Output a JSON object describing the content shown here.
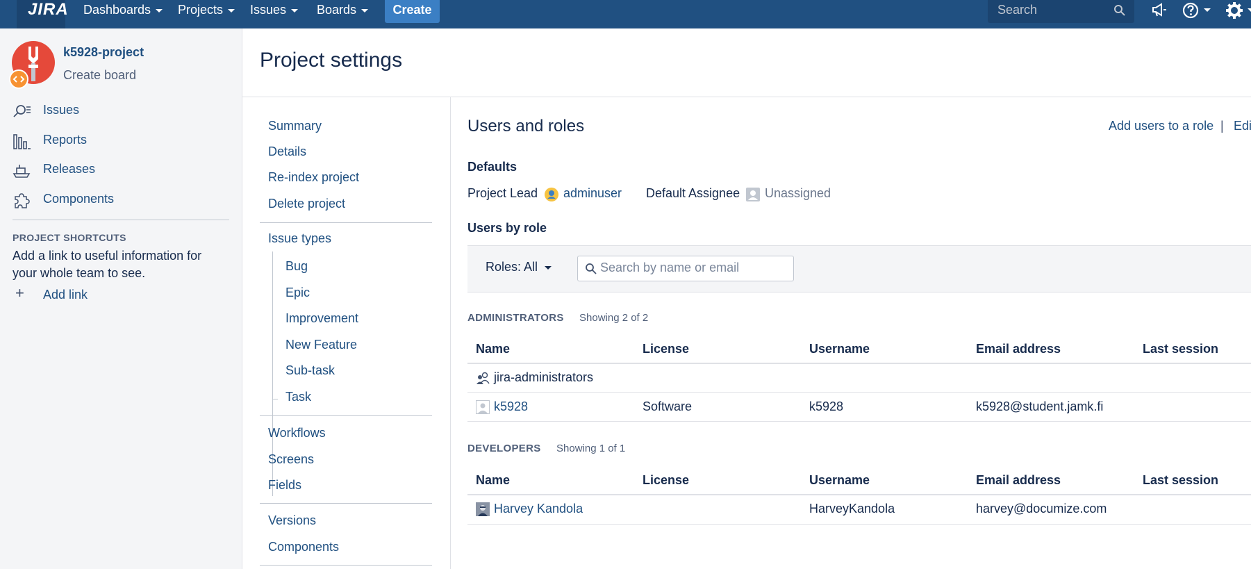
{
  "nav": {
    "logo": "JIRA",
    "items": [
      {
        "label": "Dashboards"
      },
      {
        "label": "Projects"
      },
      {
        "label": "Issues"
      },
      {
        "label": "Boards"
      }
    ],
    "create_label": "Create",
    "search_placeholder": "Search",
    "colors": {
      "bar": "#205081",
      "create": "#3b7fc4"
    }
  },
  "sidebar": {
    "project_name": "k5928-project",
    "create_board": "Create board",
    "links": [
      {
        "label": "Issues",
        "icon": "issues-icon"
      },
      {
        "label": "Reports",
        "icon": "reports-icon"
      },
      {
        "label": "Releases",
        "icon": "releases-icon"
      },
      {
        "label": "Components",
        "icon": "components-icon"
      }
    ],
    "shortcuts_heading": "PROJECT SHORTCUTS",
    "shortcuts_text_1": "Add a link to useful information for",
    "shortcuts_text_2": "your whole team to see.",
    "add_link": "Add link"
  },
  "page": {
    "title": "Project settings"
  },
  "settings_nav": {
    "group1": [
      "Summary",
      "Details",
      "Re-index project",
      "Delete project"
    ],
    "issue_types": "Issue types",
    "issue_type_children": [
      "Bug",
      "Epic",
      "Improvement",
      "New Feature",
      "Sub-task",
      "Task"
    ],
    "group3": [
      "Workflows",
      "Screens",
      "Fields"
    ],
    "group4": [
      "Versions",
      "Components"
    ]
  },
  "content": {
    "title": "Users and roles",
    "add_users_link": "Add users to a role",
    "separator": "|",
    "edit_link": "Edi",
    "defaults_heading": "Defaults",
    "project_lead_label": "Project Lead",
    "project_lead_value": "adminuser",
    "default_assignee_label": "Default Assignee",
    "default_assignee_value": "Unassigned",
    "users_by_role_heading": "Users by role",
    "roles_filter": "Roles: All",
    "search_placeholder": "Search by name or email",
    "columns": [
      "Name",
      "License",
      "Username",
      "Email address",
      "Last session"
    ],
    "administrators": {
      "label": "ADMINISTRATORS",
      "count": "Showing 2 of 2",
      "rows": [
        {
          "name": "jira-administrators",
          "license": "",
          "username": "",
          "email": "",
          "last_session": ""
        },
        {
          "name": "k5928",
          "license": "Software",
          "username": "k5928",
          "email": "k5928@student.jamk.fi",
          "last_session": ""
        }
      ]
    },
    "developers": {
      "label": "DEVELOPERS",
      "count": "Showing 1 of 1",
      "rows": [
        {
          "name": "Harvey Kandola",
          "license": "",
          "username": "HarveyKandola",
          "email": "harvey@documize.com",
          "last_session": ""
        }
      ]
    }
  }
}
